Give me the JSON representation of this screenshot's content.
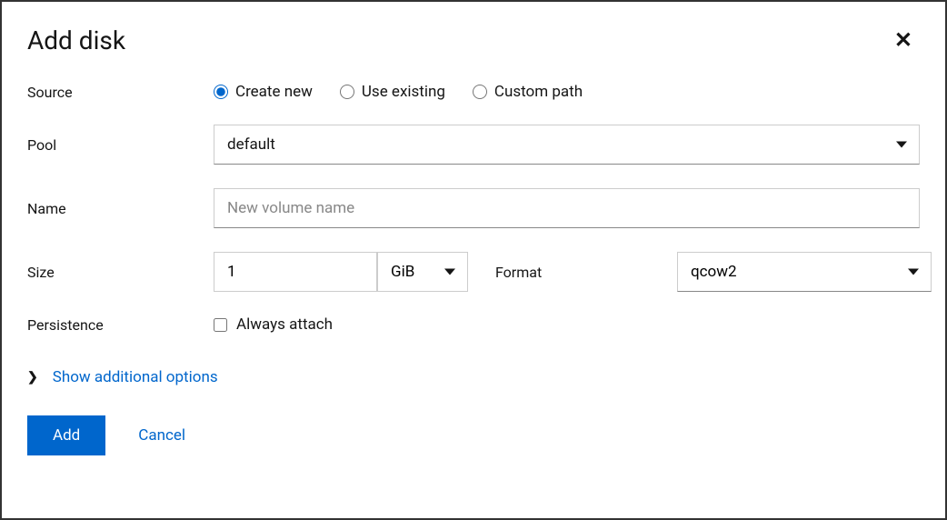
{
  "modal": {
    "title": "Add disk"
  },
  "labels": {
    "source": "Source",
    "pool": "Pool",
    "name": "Name",
    "size": "Size",
    "format": "Format",
    "persistence": "Persistence"
  },
  "source": {
    "options": {
      "create_new": "Create new",
      "use_existing": "Use existing",
      "custom_path": "Custom path"
    },
    "selected": "create_new"
  },
  "pool": {
    "value": "default"
  },
  "name": {
    "placeholder": "New volume name",
    "value": ""
  },
  "size": {
    "value": "1",
    "unit": "GiB"
  },
  "format": {
    "value": "qcow2"
  },
  "persistence": {
    "always_attach_label": "Always attach",
    "always_attach_checked": false
  },
  "expander": {
    "label": "Show additional options"
  },
  "footer": {
    "add": "Add",
    "cancel": "Cancel"
  }
}
